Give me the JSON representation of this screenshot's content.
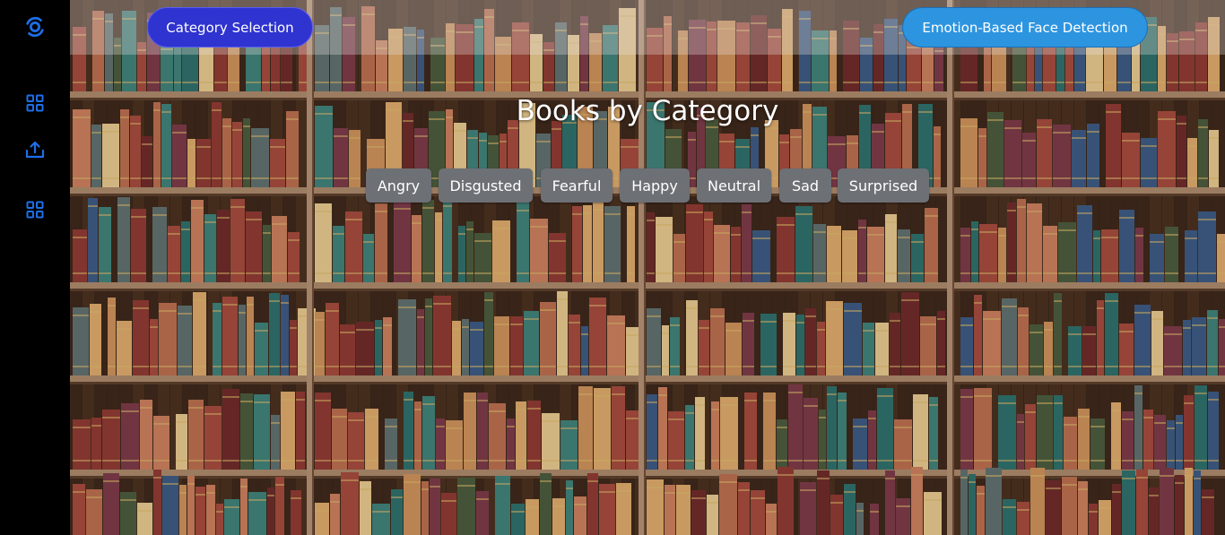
{
  "app": {
    "title": "Books by Category",
    "accent_color": "#2f33cf",
    "secondary_color": "#2d95e0",
    "sidebar_icon_color": "#1e6ee8"
  },
  "sidebar": {
    "logo_icon": "orbit-logo-icon",
    "items": [
      {
        "icon": "grid-icon"
      },
      {
        "icon": "upload-icon"
      },
      {
        "icon": "grid-icon"
      }
    ]
  },
  "header": {
    "category_button_label": "Category Selection",
    "emotion_button_label": "Emotion-Based Face Detection"
  },
  "main": {
    "heading": "Books by Category",
    "background": "bookshelf-photo",
    "categories": [
      "Angry",
      "Disgusted",
      "Fearful",
      "Happy",
      "Neutral",
      "Sad",
      "Surprised"
    ]
  }
}
